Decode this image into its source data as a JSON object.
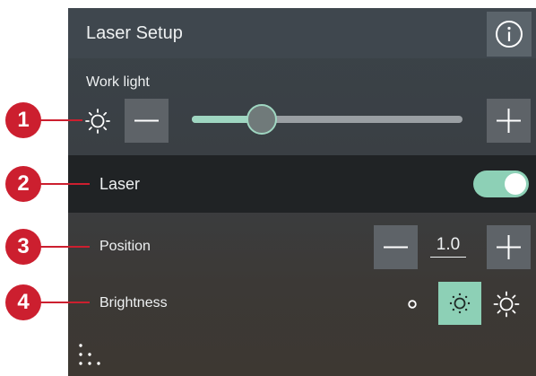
{
  "header": {
    "title": "Laser Setup",
    "info_icon": "info-circle-icon"
  },
  "work_light": {
    "label": "Work light",
    "level": 0.25,
    "sun_icon": "sun-icon",
    "decrease_icon": "minus-icon",
    "increase_icon": "plus-icon"
  },
  "laser": {
    "label": "Laser",
    "enabled": true
  },
  "position": {
    "label": "Position",
    "value": "1.0"
  },
  "brightness": {
    "label": "Brightness",
    "options": [
      "low",
      "medium",
      "high"
    ],
    "selected": "medium"
  },
  "callouts": [
    "1",
    "2",
    "3",
    "4"
  ],
  "colors": {
    "accent": "#8dd0b6",
    "callout": "#cc1f2f",
    "titlebar": "#3f474e",
    "laser_row": "#202325"
  },
  "footer": {
    "menu_icon": "dots-menu-icon"
  }
}
